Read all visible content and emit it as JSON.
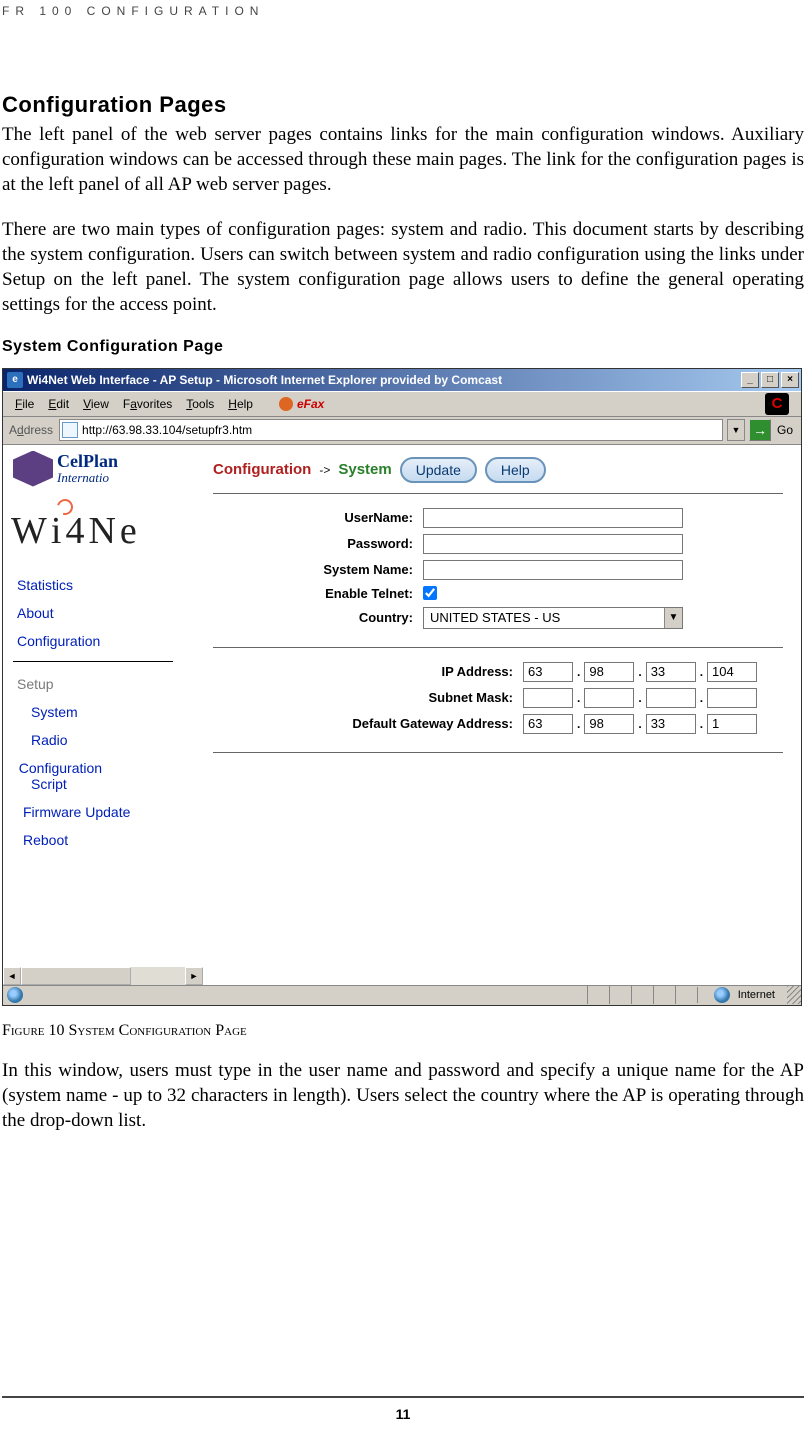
{
  "page_header": "FR 100 CONFIGURATION",
  "heading": "Configuration Pages",
  "para1": "The left panel of the web server pages contains links for the main configuration windows. Auxiliary configuration windows can be accessed through these main pages. The link for the configuration pages is at the left panel of all AP web server pages.",
  "para2": "There are two main types of configuration pages: system and radio. This document starts by describing the system configuration. Users can switch between system and radio configuration using the links under Setup on the left panel. The system configuration page allows users to define the general operating settings for the access point.",
  "subheading": "System Configuration Page",
  "window": {
    "title": "Wi4Net Web Interface - AP Setup - Microsoft Internet Explorer provided by Comcast",
    "menus": {
      "file": "File",
      "edit": "Edit",
      "view": "View",
      "favorites": "Favorites",
      "tools": "Tools",
      "help": "Help",
      "efax": "eFax"
    },
    "address_label": "Address",
    "url": "http://63.98.33.104/setupfr3.htm",
    "go_label": "Go",
    "logo": {
      "name": "CelPlan",
      "sub": "Internatio"
    },
    "wi4net": "Wi4Ne",
    "nav": {
      "statistics": "Statistics",
      "about": "About",
      "configuration": "Configuration",
      "setup": "Setup",
      "system": "System",
      "radio": "Radio",
      "cfgscript": "Configuration Script",
      "fwupdate": "Firmware Update",
      "reboot": "Reboot"
    },
    "breadcrumb": {
      "conf": "Configuration",
      "arrow": "->",
      "system": "System"
    },
    "buttons": {
      "update": "Update",
      "help": "Help"
    },
    "labels": {
      "username": "UserName:",
      "password": "Password:",
      "systemname": "System Name:",
      "enabletelnet": "Enable Telnet:",
      "country": "Country:",
      "ip": "IP Address:",
      "subnet": "Subnet Mask:",
      "gateway": "Default Gateway Address:"
    },
    "values": {
      "username": "",
      "password": "",
      "systemname": "",
      "country": "UNITED STATES - US",
      "telnet_checked": true,
      "ip": [
        "63",
        "98",
        "33",
        "104"
      ],
      "subnet": [
        "",
        "",
        "",
        ""
      ],
      "gateway": [
        "63",
        "98",
        "33",
        "1"
      ]
    },
    "status": {
      "zone": "Internet"
    }
  },
  "figure_caption": "Figure 10 System Configuration Page",
  "para3": "In this window, users must type in the user name and password and specify a unique name for the AP (system name - up to 32 characters in length). Users select the country where the AP is operating through the drop-down list.",
  "page_number": "11"
}
